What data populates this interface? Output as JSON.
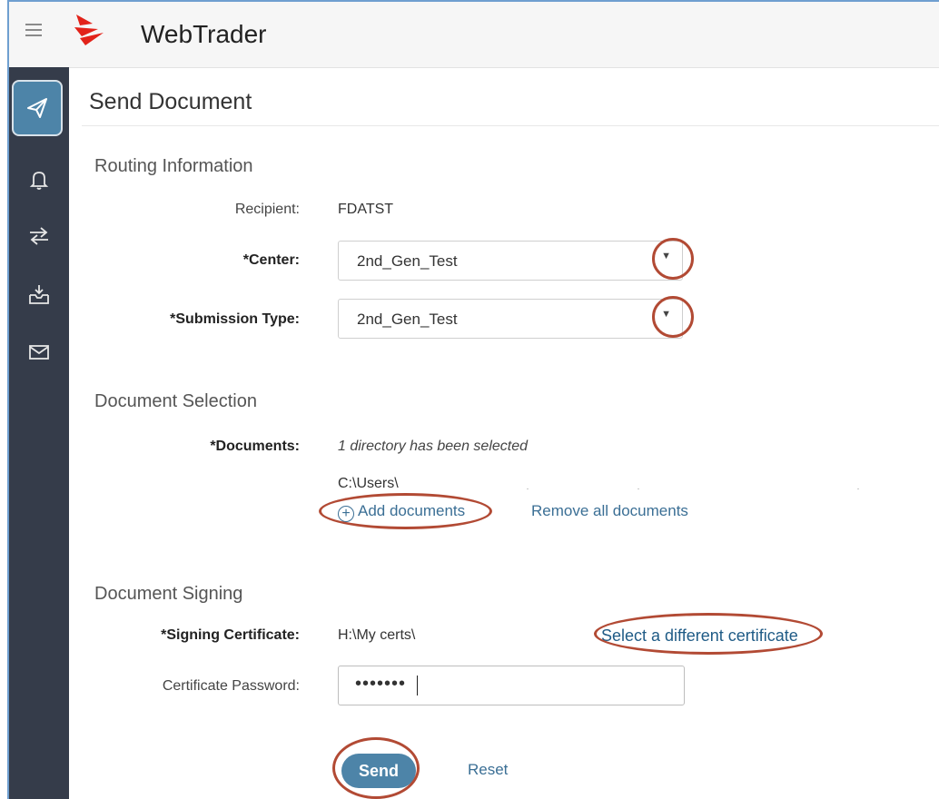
{
  "header": {
    "app_title": "WebTrader"
  },
  "sidebar": {
    "items": [
      {
        "icon": "paper-plane-icon",
        "active": true
      },
      {
        "icon": "bell-icon"
      },
      {
        "icon": "transfer-arrows-icon"
      },
      {
        "icon": "inbox-download-icon"
      },
      {
        "icon": "mail-icon"
      }
    ]
  },
  "page": {
    "title": "Send Document"
  },
  "routing": {
    "section_title": "Routing Information",
    "recipient_label": "Recipient:",
    "recipient_value": "FDATST",
    "center_label": "*Center:",
    "center_value": "2nd_Gen_Test",
    "submission_type_label": "*Submission Type:",
    "submission_type_value": "2nd_Gen_Test"
  },
  "documents": {
    "section_title": "Document Selection",
    "documents_label": "*Documents:",
    "status_text": "1 directory has been selected",
    "path": "C:\\Users\\",
    "add_link": "Add documents",
    "remove_link": "Remove all documents"
  },
  "signing": {
    "section_title": "Document Signing",
    "certificate_label": "*Signing Certificate:",
    "certificate_value": "H:\\My certs\\",
    "select_link": "Select a different certificate",
    "password_label": "Certificate Password:",
    "password_mask": "•••••••"
  },
  "actions": {
    "send_label": "Send",
    "reset_label": "Reset"
  },
  "colors": {
    "accent": "#4d84a8",
    "sidebar": "#353c4a",
    "highlight_ring": "#b24a34",
    "link": "#3b6f95"
  }
}
